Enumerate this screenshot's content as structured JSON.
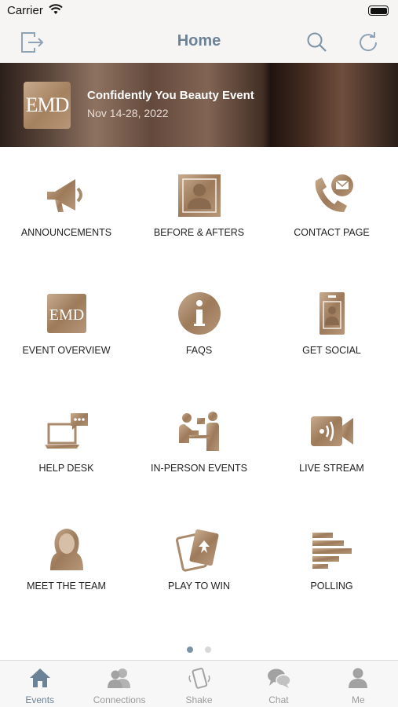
{
  "status_bar": {
    "carrier": "Carrier"
  },
  "nav": {
    "title": "Home"
  },
  "banner": {
    "logo_text": "EMD",
    "title": "Confidently You Beauty Event",
    "date": "Nov 14-28, 2022"
  },
  "tiles": [
    {
      "label": "ANNOUNCEMENTS",
      "icon": "megaphone-icon"
    },
    {
      "label": "BEFORE & AFTERS",
      "icon": "portrait-photo-icon"
    },
    {
      "label": "CONTACT PAGE",
      "icon": "phone-mail-icon"
    },
    {
      "label": "EVENT OVERVIEW",
      "icon": "emd-logo-icon"
    },
    {
      "label": "FAQS",
      "icon": "info-icon"
    },
    {
      "label": "GET SOCIAL",
      "icon": "id-badge-icon"
    },
    {
      "label": "HELP DESK",
      "icon": "laptop-chat-icon"
    },
    {
      "label": "IN-PERSON EVENTS",
      "icon": "people-meeting-icon"
    },
    {
      "label": "LIVE STREAM",
      "icon": "video-camera-icon"
    },
    {
      "label": "MEET THE TEAM",
      "icon": "woman-avatar-icon"
    },
    {
      "label": "PLAY TO WIN",
      "icon": "playing-cards-icon"
    },
    {
      "label": "POLLING",
      "icon": "bar-chart-icon"
    }
  ],
  "pager": {
    "pages": 2,
    "current": 1
  },
  "tabs": [
    {
      "label": "Events",
      "icon": "home-icon",
      "active": true
    },
    {
      "label": "Connections",
      "icon": "people-icon",
      "active": false
    },
    {
      "label": "Shake",
      "icon": "shake-phone-icon",
      "active": false
    },
    {
      "label": "Chat",
      "icon": "chat-bubbles-icon",
      "active": false
    },
    {
      "label": "Me",
      "icon": "person-icon",
      "active": false
    }
  ],
  "colors": {
    "accent": "#6c8296",
    "icon_gold": "#a98a6c",
    "tab_inactive": "#9a9a9a",
    "bar_bg": "#f7f4f4"
  }
}
